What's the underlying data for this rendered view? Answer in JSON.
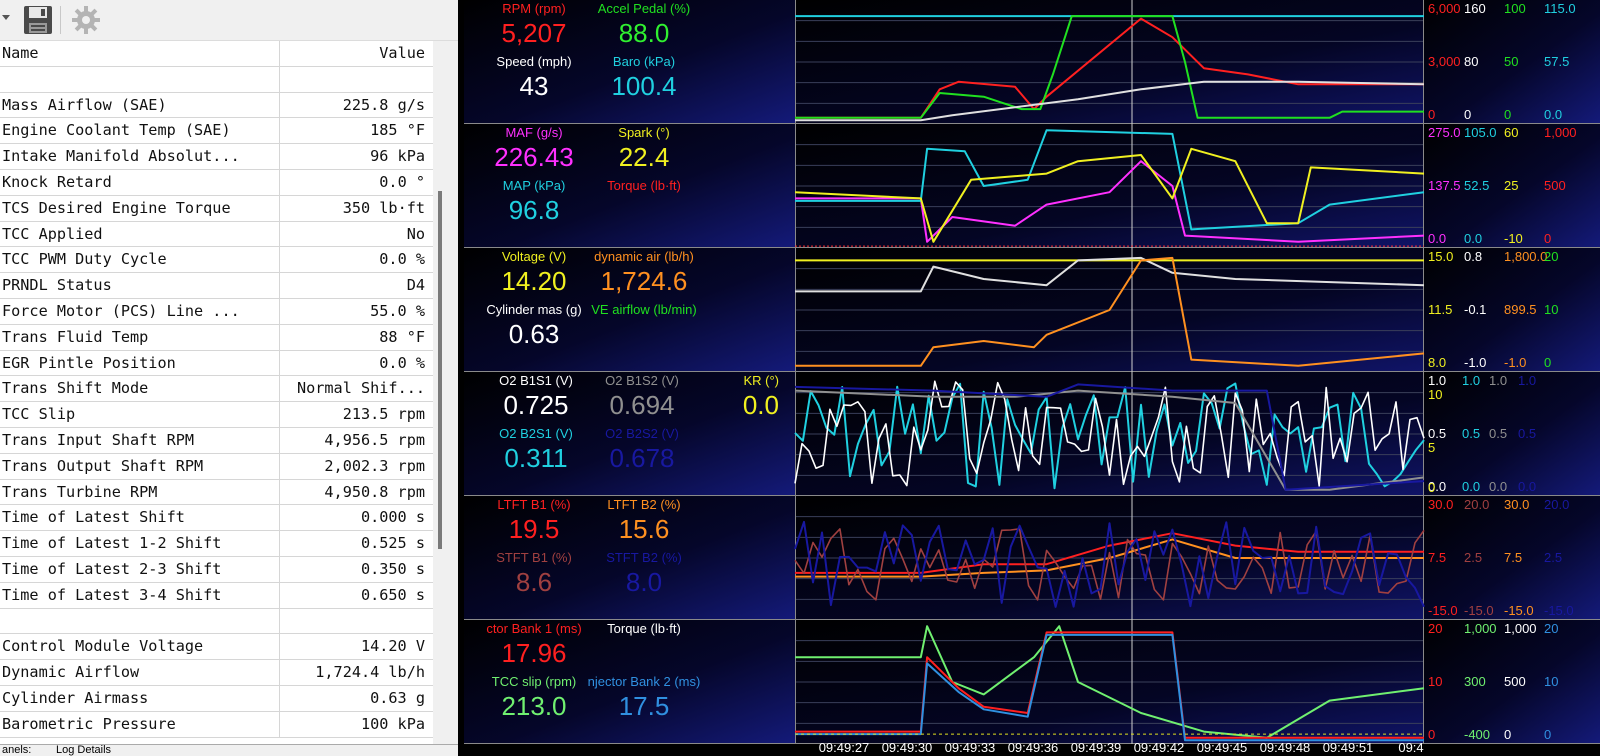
{
  "toolbar": {
    "items": [
      {
        "name": "dropdown-arrow"
      },
      {
        "name": "save-icon"
      },
      {
        "name": "gear-icon"
      }
    ]
  },
  "grid": {
    "col_name": "Name",
    "col_value": "Value",
    "rows": [
      {
        "name": "",
        "value": ""
      },
      {
        "name": "Mass Airflow (SAE)",
        "value": "225.8 g/s"
      },
      {
        "name": "Engine Coolant Temp (SAE)",
        "value": "185 °F"
      },
      {
        "name": "Intake Manifold Absolut...",
        "value": "96 kPa"
      },
      {
        "name": "Knock Retard",
        "value": "0.0 °"
      },
      {
        "name": "TCS Desired Engine Torque",
        "value": "350 lb·ft"
      },
      {
        "name": "TCC Applied",
        "value": "No"
      },
      {
        "name": "TCC PWM Duty Cycle",
        "value": "0.0 %"
      },
      {
        "name": "PRNDL Status",
        "value": "D4"
      },
      {
        "name": "Force Motor (PCS) Line ...",
        "value": "55.0 %"
      },
      {
        "name": "Trans Fluid Temp",
        "value": "88 °F"
      },
      {
        "name": "EGR Pintle Position",
        "value": "0.0 %"
      },
      {
        "name": "Trans Shift Mode",
        "value": "Normal Shif..."
      },
      {
        "name": "TCC Slip",
        "value": "213.5 rpm"
      },
      {
        "name": "Trans Input Shaft RPM",
        "value": "4,956.5 rpm"
      },
      {
        "name": "Trans Output Shaft RPM",
        "value": "2,002.3 rpm"
      },
      {
        "name": "Trans Turbine RPM",
        "value": "4,950.8 rpm"
      },
      {
        "name": "Time of Latest Shift",
        "value": "0.000 s"
      },
      {
        "name": "Time of Latest 1-2 Shift",
        "value": "0.525 s"
      },
      {
        "name": "Time of Latest 2-3 Shift",
        "value": "0.350 s"
      },
      {
        "name": "Time of Latest 3-4 Shift",
        "value": "0.650 s"
      },
      {
        "name": "",
        "value": ""
      },
      {
        "name": "Control Module Voltage",
        "value": "14.20 V"
      },
      {
        "name": "Dynamic Airflow",
        "value": "1,724.4 lb/h"
      },
      {
        "name": "Cylinder Airmass",
        "value": "0.63 g"
      },
      {
        "name": "Barometric Pressure",
        "value": "100 kPa"
      }
    ]
  },
  "bottom_tabs": [
    "anels:",
    "Log Details"
  ],
  "dashboard": {
    "time_labels": [
      "09:49:27",
      "09:49:30",
      "09:49:33",
      "09:49:36",
      "09:49:39",
      "09:49:42",
      "09:49:45",
      "09:49:48",
      "09:49:51",
      "09:4"
    ],
    "panels": [
      {
        "gauges": [
          {
            "label": "RPM (rpm)",
            "value": "5,207",
            "label_color": "#ff2020",
            "value_color": "#ff2020"
          },
          {
            "label": "Accel Pedal (%)",
            "value": "88.0",
            "label_color": "#20e020",
            "value_color": "#30f030"
          },
          {
            "label": "Speed (mph)",
            "value": "43",
            "label_color": "#ffffff",
            "value_color": "#ffffff"
          },
          {
            "label": "Baro (kPa)",
            "value": "100.4",
            "label_color": "#20d0e0",
            "value_color": "#20d0e0"
          }
        ],
        "scales": [
          {
            "top": "6,000",
            "mid": "3,000",
            "bot": "0",
            "color": "#ff2020"
          },
          {
            "top": "160",
            "mid": "80",
            "bot": "0",
            "color": "#ffffff"
          },
          {
            "top": "100",
            "mid": "50",
            "bot": "0",
            "color": "#20e020"
          },
          {
            "top": "115.0",
            "mid": "57.5",
            "bot": "0.0",
            "color": "#20d0e0"
          }
        ]
      },
      {
        "gauges": [
          {
            "label": "MAF (g/s)",
            "value": "226.43",
            "label_color": "#ff30ff",
            "value_color": "#ff30ff"
          },
          {
            "label": "Spark (°)",
            "value": "22.4",
            "label_color": "#f0f020",
            "value_color": "#f0f020"
          },
          {
            "label": "MAP (kPa)",
            "value": "96.8",
            "label_color": "#20d0e0",
            "value_color": "#20d0e0"
          },
          {
            "label": "Torque (lb·ft)",
            "value": "",
            "label_color": "#ff2020",
            "value_color": "#ff2020"
          }
        ],
        "scales": [
          {
            "top": "275.0",
            "mid": "137.5",
            "bot": "0.0",
            "color": "#ff30ff"
          },
          {
            "top": "105.0",
            "mid": "52.5",
            "bot": "0.0",
            "color": "#20d0e0"
          },
          {
            "top": "60",
            "mid": "25",
            "bot": "-10",
            "color": "#f0f020"
          },
          {
            "top": "1,000",
            "mid": "500",
            "bot": "0",
            "color": "#ff2020"
          }
        ]
      },
      {
        "gauges": [
          {
            "label": "Voltage (V)",
            "value": "14.20",
            "label_color": "#f0f020",
            "value_color": "#f0f020"
          },
          {
            "label": "dynamic air (lb/h)",
            "value": "1,724.6",
            "label_color": "#ff9020",
            "value_color": "#ff9020"
          },
          {
            "label": "Cylinder mas (g)",
            "value": "0.63",
            "label_color": "#ffffff",
            "value_color": "#ffffff"
          },
          {
            "label": "VE airflow (lb/min)",
            "value": "",
            "label_color": "#20e020",
            "value_color": "#20e020"
          }
        ],
        "scales": [
          {
            "top": "15.0",
            "mid": "11.5",
            "bot": "8.0",
            "color": "#f0f020"
          },
          {
            "top": "0.8",
            "mid": "-0.1",
            "bot": "-1.0",
            "color": "#ffffff"
          },
          {
            "top": "1,800.0",
            "mid": "899.5",
            "bot": "-1.0",
            "color": "#ff9020"
          },
          {
            "top": "20",
            "mid": "10",
            "bot": "0",
            "color": "#20e020"
          }
        ]
      },
      {
        "gauges": [
          {
            "label": "O2 B1S1 (V)",
            "value": "0.725",
            "label_color": "#ffffff",
            "value_color": "#ffffff"
          },
          {
            "label": "O2 B1S2 (V)",
            "value": "0.694",
            "label_color": "#909090",
            "value_color": "#909090"
          },
          {
            "label": "KR (°)",
            "value": "0.0",
            "label_color": "#f0f020",
            "value_color": "#f0f020"
          },
          {
            "label": "O2 B2S1 (V)",
            "value": "0.311",
            "label_color": "#20d0e0",
            "value_color": "#20d0e0"
          },
          {
            "label": "O2 B2S2 (V)",
            "value": "0.678",
            "label_color": "#1818a0",
            "value_color": "#1818a0"
          }
        ],
        "scales": [
          {
            "top": "1.0",
            "mid": "0.5",
            "bot": "0.0",
            "color": "#ffffff"
          },
          {
            "top": "1.0",
            "mid": "0.5",
            "bot": "0.0",
            "color": "#20d0e0"
          },
          {
            "top": "1.0",
            "mid": "0.5",
            "bot": "0.0",
            "color": "#909090"
          },
          {
            "top": "1.0",
            "mid": "0.5",
            "bot": "0.0",
            "color": "#1818a0"
          },
          {
            "top": "10",
            "mid": "5",
            "bot": "0",
            "color": "#f0f020"
          }
        ]
      },
      {
        "gauges": [
          {
            "label": "LTFT B1 (%)",
            "value": "19.5",
            "label_color": "#ff2020",
            "value_color": "#ff2020"
          },
          {
            "label": "LTFT B2 (%)",
            "value": "15.6",
            "label_color": "#ff9020",
            "value_color": "#ff9020"
          },
          {
            "label": "STFT B1 (%)",
            "value": "8.6",
            "label_color": "#a04040",
            "value_color": "#a04040"
          },
          {
            "label": "STFT B2 (%)",
            "value": "8.0",
            "label_color": "#1818a0",
            "value_color": "#1818a0"
          }
        ],
        "scales": [
          {
            "top": "30.0",
            "mid": "7.5",
            "bot": "-15.0",
            "color": "#ff2020"
          },
          {
            "top": "20.0",
            "mid": "2.5",
            "bot": "-15.0",
            "color": "#a04040"
          },
          {
            "top": "30.0",
            "mid": "7.5",
            "bot": "-15.0",
            "color": "#ff9020"
          },
          {
            "top": "20.0",
            "mid": "2.5",
            "bot": "-15.0",
            "color": "#1818a0"
          }
        ]
      },
      {
        "gauges": [
          {
            "label": "ctor Bank 1 (ms)",
            "value": "17.96",
            "label_color": "#ff2020",
            "value_color": "#ff2020"
          },
          {
            "label": "Torque (lb·ft)",
            "value": "",
            "label_color": "#ffffff",
            "value_color": "#ffffff"
          },
          {
            "label": "TCC slip (rpm)",
            "value": "213.0",
            "label_color": "#70f070",
            "value_color": "#70f070"
          },
          {
            "label": "njector Bank 2 (ms)",
            "value": "17.5",
            "label_color": "#3090e0",
            "value_color": "#3090e0"
          }
        ],
        "scales": [
          {
            "top": "20",
            "mid": "10",
            "bot": "0",
            "color": "#ff2020"
          },
          {
            "top": "1,000",
            "mid": "300",
            "bot": "-400",
            "color": "#70f070"
          },
          {
            "top": "1,000",
            "mid": "500",
            "bot": "0",
            "color": "#ffffff"
          },
          {
            "top": "20",
            "mid": "10",
            "bot": "0",
            "color": "#3090e0"
          }
        ]
      }
    ]
  }
}
